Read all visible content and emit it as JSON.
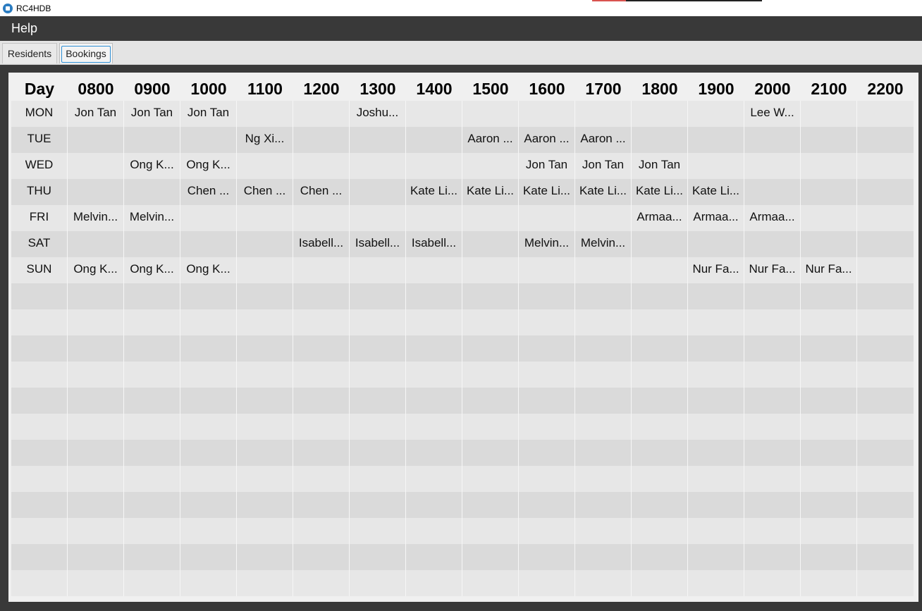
{
  "window": {
    "title": "RC4HDB"
  },
  "menu": {
    "items": [
      "Help"
    ]
  },
  "tabs": [
    {
      "label": "Residents",
      "selected": false
    },
    {
      "label": "Bookings",
      "selected": true
    }
  ],
  "schedule": {
    "columns": [
      "Day",
      "0800",
      "0900",
      "1000",
      "1100",
      "1200",
      "1300",
      "1400",
      "1500",
      "1600",
      "1700",
      "1800",
      "1900",
      "2000",
      "2100",
      "2200"
    ],
    "rows": [
      {
        "day": "MON",
        "slots": [
          "Jon Tan",
          "Jon Tan",
          "Jon Tan",
          "",
          "",
          "Joshu...",
          "",
          "",
          "",
          "",
          "",
          "",
          "Lee W...",
          "",
          ""
        ]
      },
      {
        "day": "TUE",
        "slots": [
          "",
          "",
          "",
          "Ng Xi...",
          "",
          "",
          "",
          "Aaron ...",
          "Aaron ...",
          "Aaron ...",
          "",
          "",
          "",
          "",
          ""
        ]
      },
      {
        "day": "WED",
        "slots": [
          "",
          "Ong K...",
          "Ong K...",
          "",
          "",
          "",
          "",
          "",
          "Jon Tan",
          "Jon Tan",
          "Jon Tan",
          "",
          "",
          "",
          ""
        ]
      },
      {
        "day": "THU",
        "slots": [
          "",
          "",
          "Chen ...",
          "Chen ...",
          "Chen ...",
          "",
          "Kate Li...",
          "Kate Li...",
          "Kate Li...",
          "Kate Li...",
          "Kate Li...",
          "Kate Li...",
          "",
          "",
          ""
        ]
      },
      {
        "day": "FRI",
        "slots": [
          "Melvin...",
          "Melvin...",
          "",
          "",
          "",
          "",
          "",
          "",
          "",
          "",
          "Armaa...",
          "Armaa...",
          "Armaa...",
          "",
          ""
        ]
      },
      {
        "day": "SAT",
        "slots": [
          "",
          "",
          "",
          "",
          "Isabell...",
          "Isabell...",
          "Isabell...",
          "",
          "Melvin...",
          "Melvin...",
          "",
          "",
          "",
          "",
          ""
        ]
      },
      {
        "day": "SUN",
        "slots": [
          "Ong K...",
          "Ong K...",
          "Ong K...",
          "",
          "",
          "",
          "",
          "",
          "",
          "",
          "",
          "Nur Fa...",
          "Nur Fa...",
          "Nur Fa...",
          ""
        ]
      }
    ]
  }
}
